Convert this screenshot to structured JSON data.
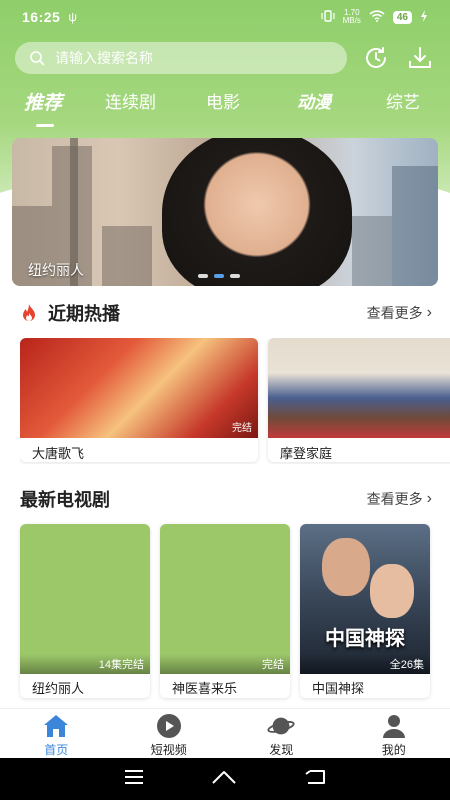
{
  "status_bar": {
    "time": "16:25",
    "net_speed": "1.70",
    "net_unit": "MB/s",
    "battery": "46"
  },
  "search": {
    "placeholder": "请输入搜索名称"
  },
  "header_icons": [
    "history-icon",
    "download-icon"
  ],
  "tabs": [
    {
      "label": "推荐",
      "active": true
    },
    {
      "label": "连续剧",
      "active": false
    },
    {
      "label": "电影",
      "active": false
    },
    {
      "label": "动漫",
      "active": false
    },
    {
      "label": "综艺",
      "active": false
    }
  ],
  "banner": {
    "title": "纽约丽人",
    "page_count": 3,
    "active_index": 1
  },
  "hot": {
    "title": "近期热播",
    "more": "查看更多",
    "items": [
      {
        "title": "大唐歌飞",
        "badge": "完结"
      },
      {
        "title": "摩登家庭",
        "badge": ""
      }
    ]
  },
  "tv": {
    "title": "最新电视剧",
    "more": "查看更多",
    "items": [
      {
        "title": "纽约丽人",
        "badge": "14集完结"
      },
      {
        "title": "神医喜来乐",
        "badge": "完结"
      },
      {
        "title": "中国神探",
        "badge": "全26集",
        "poster_text": "中国神探"
      }
    ]
  },
  "bottom_nav": [
    {
      "label": "首页",
      "icon": "home-icon",
      "active": true
    },
    {
      "label": "短视频",
      "icon": "play-icon",
      "active": false
    },
    {
      "label": "发现",
      "icon": "planet-icon",
      "active": false
    },
    {
      "label": "我的",
      "icon": "person-icon",
      "active": false
    }
  ],
  "colors": {
    "brand_green": "#8fce6a",
    "active_blue": "#3b86d9",
    "fire_red": "#e8432e"
  }
}
